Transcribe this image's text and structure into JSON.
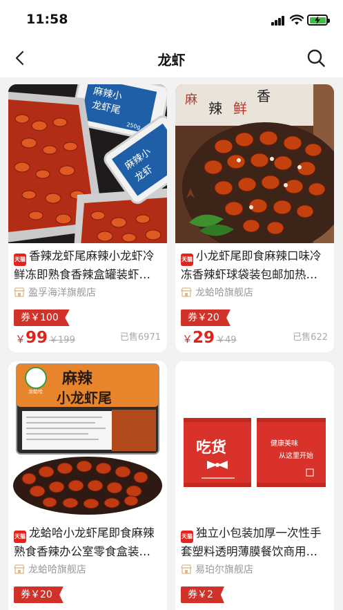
{
  "status_bar": {
    "time": "11:58",
    "battery_color": "#3cc043"
  },
  "nav": {
    "title": "龙虾",
    "back_icon": "chevron-left-icon",
    "search_icon": "search-icon"
  },
  "brand": {
    "price_color": "#e0241b",
    "coupon_color": "#d0322a",
    "badge_color": "#e4241c",
    "badge_text": "天猫"
  },
  "products": [
    {
      "title": "香辣龙虾尾麻辣小龙虾冷鲜冻即熟食香辣盒罐装虾…",
      "store": "盈孚海洋旗舰店",
      "coupon": "券￥100",
      "price_symbol": "￥",
      "price": "99",
      "original_price": "￥199",
      "sold": "已售6971",
      "image_text": [
        "麻辣小",
        "龙虾尾",
        "250g",
        "麻辣小",
        "龙虾"
      ]
    },
    {
      "title": "小龙虾尾即食麻辣口味冷冻香辣虾球袋装包邮加热…",
      "store": "龙蛤哈旗舰店",
      "coupon": "券￥20",
      "price_symbol": "￥",
      "price": "29",
      "original_price": "￥49",
      "sold": "已售622",
      "image_text": [
        "麻",
        "辣",
        "鲜",
        "香"
      ]
    },
    {
      "title": "龙蛤哈小龙虾尾即食麻辣熟食香辣办公室零食盒装…",
      "store": "龙蛤哈旗舰店",
      "coupon": "券￥20",
      "price_symbol": "￥",
      "price": "",
      "original_price": "",
      "sold": "",
      "image_text": [
        "龙蛤哈",
        "麻辣",
        "小龙虾尾"
      ]
    },
    {
      "title": "独立小包装加厚一次性手套塑料透明薄膜餐饮商用…",
      "store": "易珀尔旗舰店",
      "coupon": "券￥2",
      "price_symbol": "￥",
      "price": "",
      "original_price": "",
      "sold": "",
      "image_text": [
        "吃货",
        "健康美味",
        "从这里开始"
      ]
    }
  ]
}
